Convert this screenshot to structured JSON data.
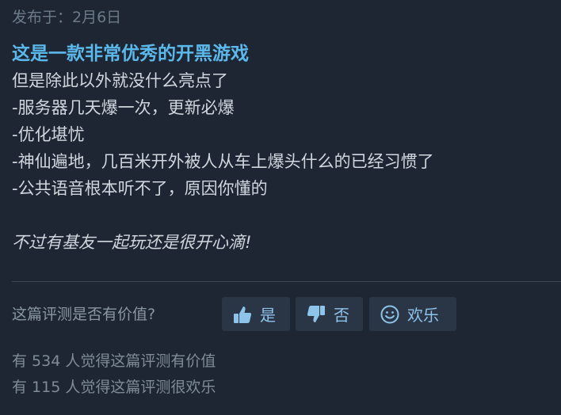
{
  "review": {
    "posted": "发布于：2月6日",
    "headline": "这是一款非常优秀的开黑游戏",
    "lines": [
      "但是除此以外就没什么亮点了",
      "-服务器几天爆一次，更新必爆",
      "-优化堪忧",
      "-神仙遍地，几百米开外被人从车上爆头什么的已经习惯了",
      "-公共语音根本听不了，原因你懂的"
    ],
    "closing": "不过有基友一起玩还是很开心滴!"
  },
  "feedback": {
    "question": "这篇评测是否有价值?",
    "yes_label": "是",
    "no_label": "否",
    "funny_label": "欢乐",
    "helpful_count": "有 534 人觉得这篇评测有价值",
    "funny_count": "有 115 人觉得这篇评测很欢乐"
  },
  "colors": {
    "background": "#1e2633",
    "headline": "#5bb8ea",
    "button_bg": "#2a3545",
    "button_text": "#8fc4ea"
  },
  "icons": {
    "yes": "thumbs-up-icon",
    "no": "thumbs-down-icon",
    "funny": "smiley-icon"
  }
}
